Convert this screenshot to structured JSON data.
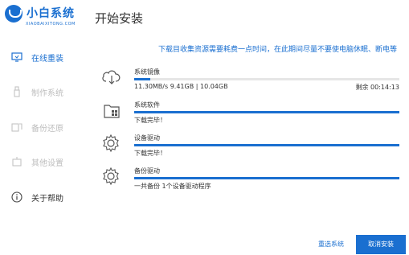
{
  "app": {
    "name": "小白系统",
    "subtitle": "XIAOBAIXITONG.COM",
    "brand_color": "#1a6fd0"
  },
  "sidebar": {
    "items": [
      {
        "label": "在线重装",
        "icon": "monitor-icon",
        "active": true
      },
      {
        "label": "制作系统",
        "icon": "usb-icon",
        "active": false
      },
      {
        "label": "备份还原",
        "icon": "backup-icon",
        "active": false
      },
      {
        "label": "其他设置",
        "icon": "settings-icon",
        "active": false
      },
      {
        "label": "关于帮助",
        "icon": "info-icon",
        "active": false
      }
    ]
  },
  "main": {
    "title": "开始安装",
    "notice": "下载目收集资源需要耗费一点时间，在此期间尽量不要使电脑休眠、断电等",
    "tasks": [
      {
        "name": "系统镜像",
        "icon": "cloud-download-icon",
        "status": "11.30MB/s 9.41GB | 10.04GB",
        "remaining": "剩余 00:14:13",
        "progress": 0.06
      },
      {
        "name": "系统软件",
        "icon": "folder-icon",
        "status": "下载完毕！",
        "remaining": "",
        "progress": 1.0
      },
      {
        "name": "设备驱动",
        "icon": "gear-icon",
        "status": "下载完毕！",
        "remaining": "",
        "progress": 1.0
      },
      {
        "name": "备份驱动",
        "icon": "gear-icon",
        "status": "一共备份 1个设备驱动程序",
        "remaining": "",
        "progress": 1.0
      }
    ]
  },
  "footer": {
    "reselect_label": "重选系统",
    "cancel_label": "取消安装"
  }
}
